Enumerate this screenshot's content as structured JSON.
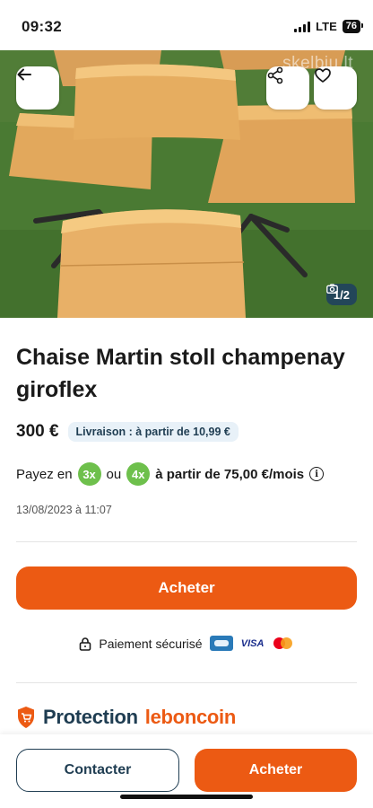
{
  "status_bar": {
    "time": "09:32",
    "network": "LTE",
    "battery": "76"
  },
  "hero": {
    "watermark": "skelbiu.lt",
    "photo_counter": "1/2",
    "icons": {
      "back": "arrow-left-icon",
      "share": "share-icon",
      "favorite": "heart-icon",
      "camera": "camera-icon"
    }
  },
  "listing": {
    "title": "Chaise Martin stoll champenay giroflex",
    "price": "300 €",
    "shipping": "Livraison : à partir de 10,99 €",
    "installments": {
      "prefix": "Payez en",
      "option_a": "3x",
      "conjunction": "ou",
      "option_b": "4x",
      "condition": "à partir de 75,00 €/mois",
      "info_icon": "i"
    },
    "date": "13/08/2023 à 11:07"
  },
  "actions": {
    "buy_label": "Acheter",
    "secure_payment": "Paiement sécurisé",
    "visa": "VISA"
  },
  "protection": {
    "label": "Protection",
    "brand": "leboncoin"
  },
  "bottom_bar": {
    "contact_label": "Contacter",
    "buy_label": "Acheter"
  },
  "colors": {
    "accent": "#ec5a13",
    "navy": "#1f3d52",
    "installment_green": "#6ec04c"
  }
}
